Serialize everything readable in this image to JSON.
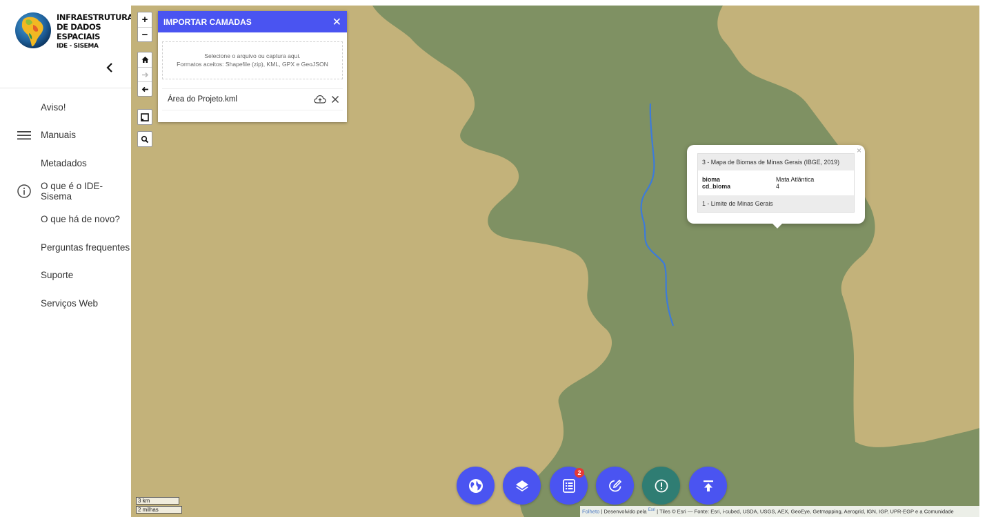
{
  "sidebar": {
    "brand_line1": "INFRAESTRUTURA",
    "brand_line2": "DE DADOS ESPACIAIS",
    "brand_line3": "IDE - SISEMA",
    "menu": [
      {
        "label": "Aviso!",
        "icon": ""
      },
      {
        "label": "Manuais",
        "icon": "hamburger-menu-icon"
      },
      {
        "label": "Metadados",
        "icon": ""
      },
      {
        "label": "O que é o IDE-Sisema",
        "icon": "info-circle-icon"
      },
      {
        "label": "O que há de novo?",
        "icon": ""
      },
      {
        "label": "Perguntas frequentes",
        "icon": ""
      },
      {
        "label": "Suporte",
        "icon": ""
      },
      {
        "label": "Serviços Web",
        "icon": ""
      }
    ]
  },
  "map_controls": {
    "zoom_in": "+",
    "zoom_out": "−",
    "home": "🏠",
    "forward": "→",
    "back": "←"
  },
  "import_panel": {
    "title": "IMPORTAR CAMADAS",
    "drop_line1": "Selecione o arquivo ou captura aqui.",
    "drop_line2": "Formatos aceitos: Shapefile (zip), KML, GPX e GeoJSON",
    "file_name": "Área do Projeto.kml"
  },
  "popup": {
    "layer_title": "3 - Mapa de Biomas de Minas Gerais (IBGE, 2019)",
    "attributes": [
      {
        "key": "bioma",
        "value": "Mata Atlântica"
      },
      {
        "key": "cd_bioma",
        "value": "4"
      }
    ],
    "footer_layer": "1 - Limite de Minas Gerais",
    "close": "×"
  },
  "toolbar": {
    "buttons": [
      "globe-icon",
      "layers-icon",
      "list-icon",
      "draw-edit-icon",
      "alert-icon",
      "upload-icon"
    ],
    "badge_count": "2"
  },
  "scale": {
    "metric": "3 km",
    "imperial": "2 milhas"
  },
  "attribution": {
    "leaflet": "Folheto",
    "powered": " | Desenvolvido pela ",
    "esri": "Esri",
    "tiles": " | Tiles © Esri — Fonte: Esri, i-cubed, USDA, USGS, AEX, GeoEye, Getmapping, Aerogrid, IGN, IGP, UPR-EGP e a Comunidade"
  },
  "colors": {
    "accent": "#4a54f1",
    "map_sand": "#c3b27a",
    "map_green": "#7f9163",
    "river": "#3d7bd9",
    "alt_button": "#2f7d73",
    "badge": "#e53935"
  }
}
